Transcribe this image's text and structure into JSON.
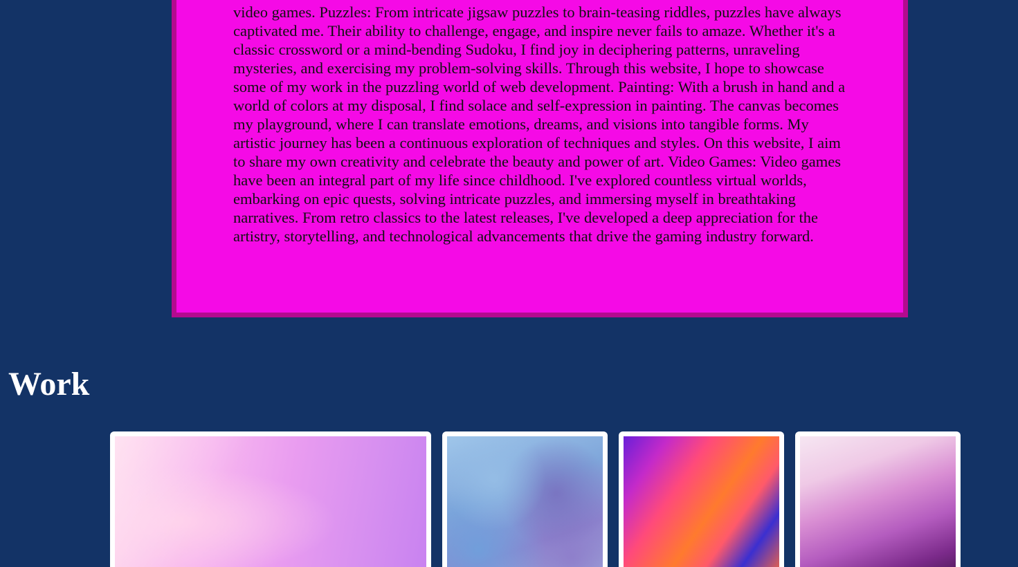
{
  "about": {
    "text": "video games. Puzzles: From intricate jigsaw puzzles to brain-teasing riddles, puzzles have always captivated me. Their ability to challenge, engage, and inspire never fails to amaze. Whether it's a classic crossword or a mind-bending Sudoku, I find joy in deciphering patterns, unraveling mysteries, and exercising my problem-solving skills. Through this website, I hope to showcase some of my work in the puzzling world of web development. Painting: With a brush in hand and a world of colors at my disposal, I find solace and self-expression in painting. The canvas becomes my playground, where I can translate emotions, dreams, and visions into tangible forms. My artistic journey has been a continuous exploration of techniques and styles. On this website, I aim to share my own creativity and celebrate the beauty and power of art. Video Games: Video games have been an integral part of my life since childhood. I've explored countless virtual worlds, embarking on epic quests, solving intricate puzzles, and immersing myself in breathtaking narratives. From retro classics to the latest releases, I've developed a deep appreciation for the artistry, storytelling, and technological advancements that drive the gaming industry forward."
  },
  "work": {
    "heading": "Work"
  },
  "colors": {
    "page_background": "#133366",
    "about_background": "#f50ae6",
    "about_border": "#b30b8f",
    "card_frame": "#ffffff"
  }
}
